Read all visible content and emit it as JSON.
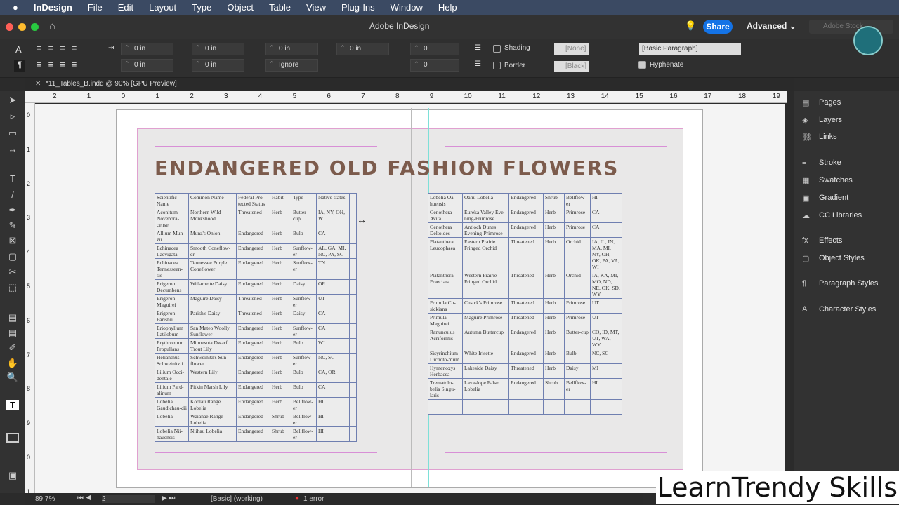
{
  "menubar": {
    "app": "InDesign",
    "items": [
      "File",
      "Edit",
      "Layout",
      "Type",
      "Object",
      "Table",
      "View",
      "Plug-Ins",
      "Window",
      "Help"
    ]
  },
  "appbar": {
    "title": "Adobe InDesign",
    "share": "Share",
    "workspace": "Advanced",
    "search_placeholder": "Adobe Stock"
  },
  "control": {
    "f1": "0 in",
    "f2": "0 in",
    "f3": "0 in",
    "f4": "0 in",
    "f5": "0 in",
    "f6": "0 in",
    "ignore": "Ignore",
    "n1": "0",
    "n2": "0",
    "shading": "Shading",
    "border": "Border",
    "fill_none": "[None]",
    "stroke_black": "[Black]",
    "para_style": "[Basic Paragraph]",
    "hyphenate": "Hyphenate"
  },
  "tab": {
    "label": "*11_Tables_B.indd @ 90% [GPU Preview]"
  },
  "ruler": {
    "h": [
      "2",
      "1",
      "0",
      "1",
      "2",
      "3",
      "4",
      "5",
      "6",
      "7",
      "8",
      "9",
      "10",
      "11",
      "12",
      "13",
      "14",
      "15",
      "16",
      "17",
      "18",
      "19"
    ],
    "v": [
      "0",
      "1",
      "2",
      "3",
      "4",
      "5",
      "6",
      "7",
      "8",
      "9",
      "0",
      "1"
    ]
  },
  "document": {
    "title": "ENDANGERED OLD FASHION FLOWERS"
  },
  "left_table": [
    [
      "Scientific Name",
      "Common Name",
      "Federal Pro-tected Status",
      "Habit",
      "Type",
      "Native states"
    ],
    [
      "Aconitum Novebora-cense",
      "Northern Wild Monkshood",
      "Threatened",
      "Herb",
      "Butter-cup",
      "IA, NY, OH, WI"
    ],
    [
      "Allium Mun-zii",
      "Munz's Onion",
      "Endangered",
      "Herb",
      "Bulb",
      "CA"
    ],
    [
      "Echinacea Laevigata",
      "Smooth Coneflow-er",
      "Endangered",
      "Herb",
      "Sunflow-er",
      "AL, GA, MI, NC, PA, SC"
    ],
    [
      "Echinacea Tennesseen-sis",
      "Tennessee Purple Coneflower",
      "Endangered",
      "Herb",
      "Sunflow-er",
      "TN"
    ],
    [
      "Erigeron Decumbens",
      "Willamette Daisy",
      "Endangered",
      "Herb",
      "Daisy",
      "OR"
    ],
    [
      "Erigeron Maguirei",
      "Maguire Daisy",
      "Threatened",
      "Herb",
      "Sunflow-er",
      "UT"
    ],
    [
      "Erigeron Parishii",
      "Parish's Daisy",
      "Threatened",
      "Herb",
      "Daisy",
      "CA"
    ],
    [
      "Eriophyllum Latilobum",
      "San Mateo Woolly Sunflower",
      "Endangered",
      "Herb",
      "Sunflow-er",
      "CA"
    ],
    [
      "Erythronium Propullans",
      "Minnesota Dwarf Trout Lily",
      "Endangered",
      "Herb",
      "Bulb",
      "WI"
    ],
    [
      "Helianthus Schweinitzii",
      "Schweinitz's Sun-flower",
      "Endangered",
      "Herb",
      "Sunflow-er",
      "NC, SC"
    ],
    [
      "Lilium Occi-dentale",
      "Western Lily",
      "Endangered",
      "Herb",
      "Bulb",
      "CA, OR"
    ],
    [
      "Lilium Pard-alinum",
      "Pitkin Marsh Lily",
      "Endangered",
      "Herb",
      "Bulb",
      "CA"
    ],
    [
      "Lobelia Gaudichau-dii",
      "Koolau Range Lobelia",
      "Endangered",
      "Herb",
      "Bellflow-er",
      "HI"
    ],
    [
      "Lobelia",
      "Waianae Range Lobelia",
      "Endangered",
      "Shrub",
      "Bellflow-er",
      "HI"
    ],
    [
      "Lobelia Nii-hauensis",
      "Niihau Lobelia",
      "Endangered",
      "Shrub",
      "Bellflow-er",
      "HI"
    ]
  ],
  "right_table": [
    [
      "Lobelia Oa-huensis",
      "Oahu Lobelia",
      "Endangered",
      "Shrub",
      "Bellflow-er",
      "HI"
    ],
    [
      "Oenothera Avita",
      "Eureka Valley Eve-ning-Primrose",
      "Endangered",
      "Herb",
      "Primrose",
      "CA"
    ],
    [
      "Oenothera Deltoides",
      "Antioch Dunes Evening-Primrose",
      "Endangered",
      "Herb",
      "Primrose",
      "CA"
    ],
    [
      "Platanthera Leucophaea",
      "Eastern Prairie Fringed Orchid",
      "Threatened",
      "Herb",
      "Orchid",
      "IA, IL, IN, MA, MI, NY, OH, OK, PA, VA, WI"
    ],
    [
      "Platanthera Praeclara",
      "Western Prairie Fringed Orchid",
      "Threatened",
      "Herb",
      "Orchid",
      "IA, KA, MI, MO, ND, NE, OK, SD, WY"
    ],
    [
      "Primula Cu-sickiana",
      "Cusick's Primrose",
      "Threatened",
      "Herb",
      "Primrose",
      "UT"
    ],
    [
      "Primula Maguirei",
      "Maguire Primrose",
      "Threatened",
      "Herb",
      "Primrose",
      "UT"
    ],
    [
      "Ranunculus Acriformis",
      "Autumn Buttercup",
      "Endangered",
      "Herb",
      "Butter-cup",
      "CO, ID, MT, UT, WA, WY"
    ],
    [
      "Sisyrinchium Dichoto-mum",
      "White Irisette",
      "Endangered",
      "Herb",
      "Bulb",
      "NC, SC"
    ],
    [
      "Hymenoxys Herbacea",
      "Lakeside Daisy",
      "Threatened",
      "Herb",
      "Daisy",
      "MI"
    ],
    [
      "Trematolo-belia Singu-laris",
      "Lavaslope False Lobelia",
      "Endangered",
      "Shrub",
      "Bellflow-er",
      "HI"
    ],
    [
      "",
      "",
      "",
      "",
      "",
      ""
    ]
  ],
  "panels": [
    "Pages",
    "Layers",
    "Links",
    "Stroke",
    "Swatches",
    "Gradient",
    "CC Libraries",
    "Effects",
    "Object Styles",
    "Paragraph Styles",
    "Character Styles"
  ],
  "status": {
    "zoom": "89.7%",
    "page": "2",
    "style": "[Basic] (working)",
    "errors": "1 error"
  },
  "watermark": "LearnTrendy Skills"
}
